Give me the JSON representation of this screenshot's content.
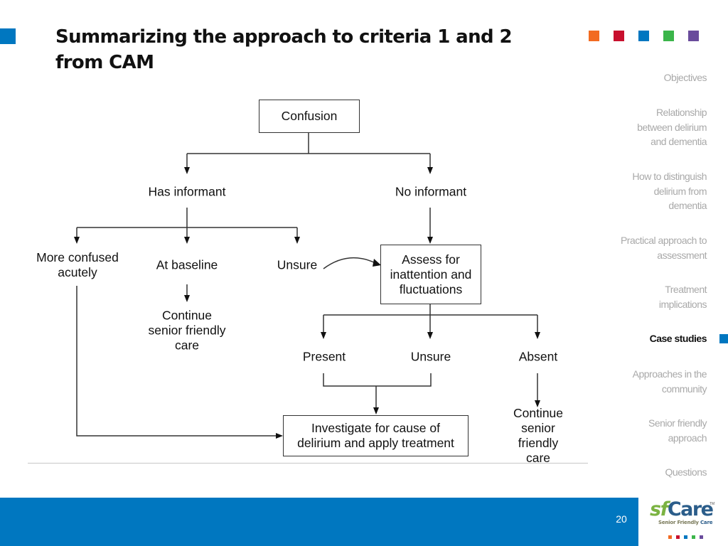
{
  "slide": {
    "title": "Summarizing the approach to criteria 1 and 2 from CAM",
    "page_number": "20",
    "accent_color": "#0077c0"
  },
  "swatches": [
    "#f26b21",
    "#c8102e",
    "#0077c0",
    "#3bb54a",
    "#6a4c9c"
  ],
  "nav": {
    "items": [
      {
        "label": "Objectives",
        "active": false
      },
      {
        "label": "Relationship\nbetween delirium\nand dementia",
        "active": false
      },
      {
        "label": "How to distinguish\ndelirium from\ndementia",
        "active": false
      },
      {
        "label": "Practical approach to\nassessment",
        "active": false
      },
      {
        "label": "Treatment\nimplications",
        "active": false
      },
      {
        "label": "Case studies",
        "active": true
      },
      {
        "label": "Approaches in the\ncommunity",
        "active": false
      },
      {
        "label": "Senior friendly\napproach",
        "active": false
      },
      {
        "label": "Questions",
        "active": false
      }
    ]
  },
  "flowchart": {
    "confusion": "Confusion",
    "has_informant": "Has informant",
    "no_informant": "No informant",
    "more_confused": "More confused\nacutely",
    "at_baseline": "At baseline",
    "unsure_1": "Unsure",
    "continue_care_1": "Continue\nsenior friendly\ncare",
    "assess": "Assess for\ninattention and\nfluctuations",
    "present": "Present",
    "unsure_2": "Unsure",
    "absent": "Absent",
    "investigate": "Investigate for cause of\ndelirium and apply treatment",
    "continue_care_2": "Continue\nsenior friendly\ncare"
  },
  "logo": {
    "brand_prefix": "sf",
    "brand_suffix": "Care",
    "trademark": "TM",
    "tagline_prefix": "Senior Friendly ",
    "tagline_suffix": "Care"
  }
}
